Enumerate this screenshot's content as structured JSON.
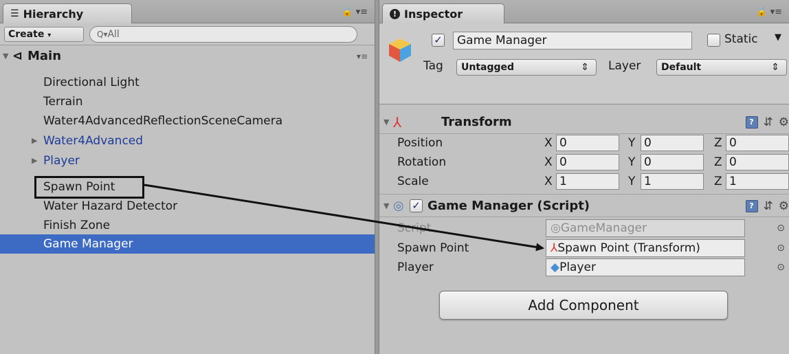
{
  "hierarchy": {
    "tab_label": "Hierarchy",
    "create_label": "Create",
    "search_placeholder": "All",
    "scene_name": "Main",
    "items": [
      {
        "label": "Directional Light"
      },
      {
        "label": "Terrain"
      },
      {
        "label": "Water4AdvancedReflectionSceneCamera"
      },
      {
        "label": "Water4Advanced"
      },
      {
        "label": "Player"
      },
      {
        "label": "Spawn Point"
      },
      {
        "label": "Water Hazard Detector"
      },
      {
        "label": "Finish Zone"
      },
      {
        "label": "Game Manager"
      }
    ]
  },
  "inspector": {
    "tab_label": "Inspector",
    "object_name": "Game Manager",
    "static_label": "Static",
    "tag_label": "Tag",
    "tag_value": "Untagged",
    "layer_label": "Layer",
    "layer_value": "Default",
    "transform": {
      "title": "Transform",
      "position_label": "Position",
      "rotation_label": "Rotation",
      "scale_label": "Scale",
      "x": "X",
      "y": "Y",
      "z": "Z",
      "position": [
        "0",
        "0",
        "0"
      ],
      "rotation": [
        "0",
        "0",
        "0"
      ],
      "scale": [
        "1",
        "1",
        "1"
      ]
    },
    "script_component": {
      "title": "Game Manager (Script)",
      "script_label": "Script",
      "script_value": "GameManager",
      "spawn_label": "Spawn Point",
      "spawn_value": "Spawn Point (Transform)",
      "player_label": "Player",
      "player_value": "Player"
    },
    "add_component_label": "Add Component"
  },
  "colors": {
    "selection": "#3d6bc4",
    "prefab_text": "#1d3b99",
    "panel_bg": "#c2c2c2"
  }
}
